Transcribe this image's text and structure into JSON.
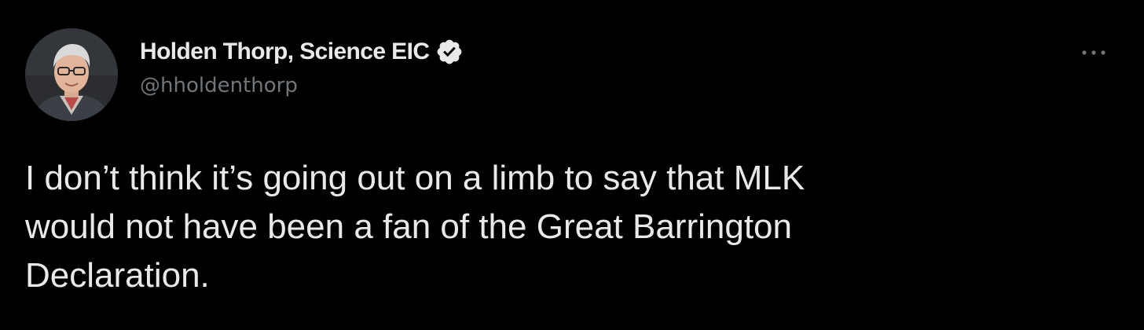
{
  "tweet": {
    "author": {
      "display_name": "Holden Thorp, Science EIC",
      "handle": "@hholdenthorp",
      "verified": true,
      "avatar_icon": "profile-photo"
    },
    "text_lines": [
      "I don’t think it’s going out on a limb to say that MLK",
      "would not have been a fan of the Great Barrington",
      "Declaration."
    ],
    "more_icon": "more-options-icon"
  },
  "colors": {
    "background": "#000000",
    "primary_text": "#e7e9ea",
    "secondary_text": "#71767b",
    "verified_badge": "#e7e9ea"
  }
}
